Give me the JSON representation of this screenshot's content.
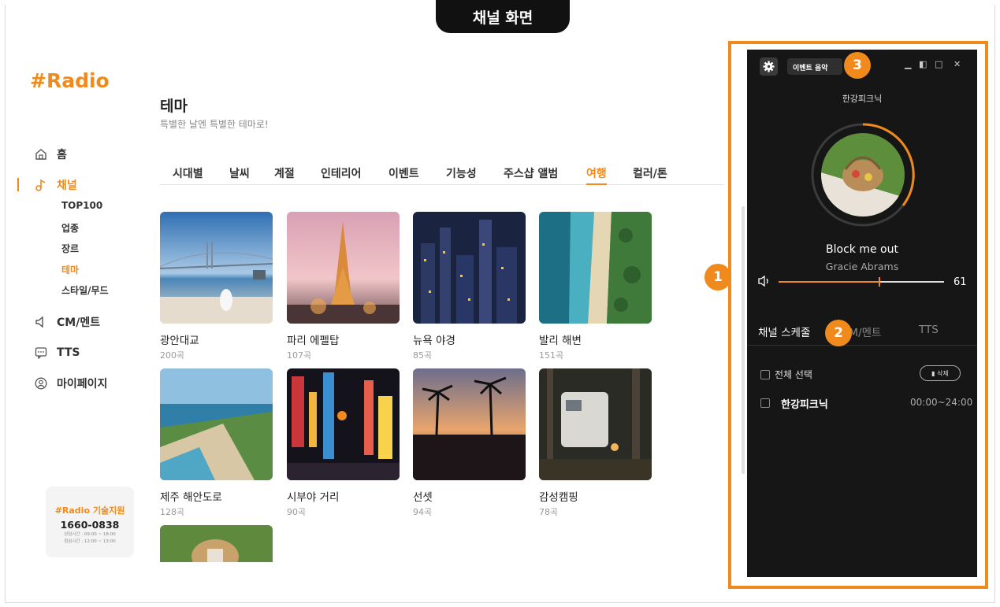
{
  "header": {
    "title": "채널 화면"
  },
  "logo": "#Radio",
  "nav": {
    "home": "홈",
    "channel": "채널",
    "sub": [
      "TOP100",
      "업종",
      "장르",
      "테마",
      "스타일/무드"
    ],
    "cm": "CM/멘트",
    "tts": "TTS",
    "mypage": "마이페이지"
  },
  "support": {
    "title": "#Radio 기술지원",
    "phone": "1660-0838",
    "hours1": "상담시간 : 09:00 ~ 18:00",
    "hours2": "점심시간 : 12:00 ~ 13:00"
  },
  "page": {
    "title": "테마",
    "subtitle": "특별한 날엔 특별한 테마로!"
  },
  "tabs": [
    "시대별",
    "날씨",
    "계절",
    "인테리어",
    "이벤트",
    "기능성",
    "주스샵 앨범",
    "여행",
    "컬러/톤"
  ],
  "active_tab": "여행",
  "cards": [
    {
      "title": "광안대교",
      "count": "200곡"
    },
    {
      "title": "파리 에펠탑",
      "count": "107곡"
    },
    {
      "title": "뉴욕 야경",
      "count": "85곡"
    },
    {
      "title": "발리 해변",
      "count": "151곡"
    },
    {
      "title": "제주 해안도로",
      "count": "128곡"
    },
    {
      "title": "시부야 거리",
      "count": "90곡"
    },
    {
      "title": "선셋",
      "count": "94곡"
    },
    {
      "title": "감성캠핑",
      "count": "78곡"
    }
  ],
  "player": {
    "event_button": "이벤트 음악",
    "now_playing_channel": "한강피크닉",
    "song_title": "Block me out",
    "artist": "Gracie Abrams",
    "volume": "61",
    "volume_level": 0.61,
    "tabs": [
      "채널 스케줄",
      "CM/멘트",
      "TTS"
    ],
    "select_all": "전체 선택",
    "delete": "삭제",
    "schedule": [
      {
        "name": "한강피크닉",
        "time": "00:00~24:00"
      }
    ]
  },
  "badges": [
    "1",
    "2",
    "3"
  ],
  "colors": {
    "accent": "#f08a1c",
    "player_bg": "#161616"
  }
}
